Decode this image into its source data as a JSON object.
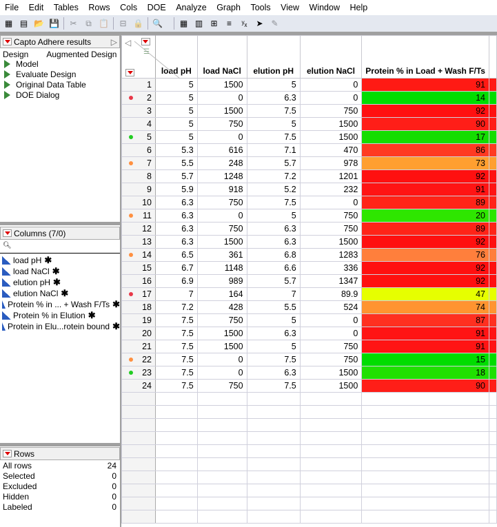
{
  "menu": [
    "File",
    "Edit",
    "Tables",
    "Rows",
    "Cols",
    "DOE",
    "Analyze",
    "Graph",
    "Tools",
    "View",
    "Window",
    "Help"
  ],
  "toolbar_icons": [
    "new-data-table-icon",
    "new-script-icon",
    "open-icon",
    "save-icon",
    "cut-icon",
    "copy-icon",
    "paste-icon",
    "formula-icon",
    "lock-icon",
    "search-icon",
    "data-grid-icon",
    "summary-icon",
    "tabulate-icon",
    "distribution-icon",
    "fit-y-by-x-icon",
    "graph-builder-icon",
    "edit-icon"
  ],
  "results_panel": {
    "title": "Capto Adhere results",
    "design_label": "Design",
    "design_value": "Augmented Design",
    "scripts": [
      "Model",
      "Evaluate Design",
      "Original Data Table",
      "DOE Dialog"
    ]
  },
  "columns_panel": {
    "title": "Columns (7/0)",
    "items": [
      "load pH",
      "load NaCl",
      "elution pH",
      "elution NaCl",
      "Protein % in ... + Wash F/Ts",
      "Protein % in Elution",
      "Protein in Elu...rotein bound"
    ]
  },
  "rows_panel": {
    "title": "Rows",
    "stats": [
      {
        "label": "All rows",
        "value": "24"
      },
      {
        "label": "Selected",
        "value": "0"
      },
      {
        "label": "Excluded",
        "value": "0"
      },
      {
        "label": "Hidden",
        "value": "0"
      },
      {
        "label": "Labeled",
        "value": "0"
      }
    ]
  },
  "table": {
    "headers": [
      "load pH",
      "load NaCl",
      "elution pH",
      "elution NaCl",
      "Protein % in Load + Wash F/Ts"
    ],
    "marker_colors": {
      "red": "#e83848",
      "green": "#22cc22",
      "orange": "#ff9040"
    },
    "rows": [
      [
        "1",
        "",
        5,
        1500,
        5,
        0,
        91,
        "#ff1a14"
      ],
      [
        "2",
        "red",
        5,
        0,
        6.3,
        0,
        14,
        "#00dd00"
      ],
      [
        "3",
        "",
        5,
        1500,
        7.5,
        750,
        92,
        "#ff1010"
      ],
      [
        "4",
        "",
        5,
        750,
        5,
        1500,
        90,
        "#ff1e18"
      ],
      [
        "5",
        "green",
        5,
        0,
        7.5,
        1500,
        17,
        "#14dd00"
      ],
      [
        "6",
        "",
        5.3,
        616,
        7.1,
        470,
        86,
        "#ff3a22"
      ],
      [
        "7",
        "orange",
        5.5,
        248,
        5.7,
        978,
        73,
        "#ff9f30"
      ],
      [
        "8",
        "",
        5.7,
        1248,
        7.2,
        1201,
        92,
        "#ff1010"
      ],
      [
        "9",
        "",
        5.9,
        918,
        5.2,
        232,
        91,
        "#ff1414"
      ],
      [
        "10",
        "",
        6.3,
        750,
        7.5,
        0,
        89,
        "#ff2418"
      ],
      [
        "11",
        "orange",
        6.3,
        0,
        5,
        750,
        20,
        "#2ee600"
      ],
      [
        "12",
        "",
        6.3,
        750,
        6.3,
        750,
        89,
        "#ff2418"
      ],
      [
        "13",
        "",
        6.3,
        1500,
        6.3,
        1500,
        92,
        "#ff1010"
      ],
      [
        "14",
        "orange",
        6.5,
        361,
        6.8,
        1283,
        76,
        "#ff7f3c"
      ],
      [
        "15",
        "",
        6.7,
        1148,
        6.6,
        336,
        92,
        "#ff1010"
      ],
      [
        "16",
        "",
        6.9,
        989,
        5.7,
        1347,
        92,
        "#ff1010"
      ],
      [
        "17",
        "red",
        7,
        164,
        7,
        89.9,
        47,
        "#e6ff00"
      ],
      [
        "18",
        "",
        7.2,
        428,
        5.5,
        524,
        74,
        "#ff9430"
      ],
      [
        "19",
        "",
        7.5,
        750,
        5,
        0,
        87,
        "#ff3020"
      ],
      [
        "20",
        "",
        7.5,
        1500,
        6.3,
        0,
        91,
        "#ff1414"
      ],
      [
        "21",
        "",
        7.5,
        1500,
        5,
        750,
        91,
        "#ff1414"
      ],
      [
        "22",
        "orange",
        7.5,
        0,
        7.5,
        750,
        15,
        "#00dd00"
      ],
      [
        "23",
        "green",
        7.5,
        0,
        6.3,
        1500,
        18,
        "#20e000"
      ],
      [
        "24",
        "",
        7.5,
        750,
        7.5,
        1500,
        90,
        "#ff1e18"
      ]
    ]
  }
}
